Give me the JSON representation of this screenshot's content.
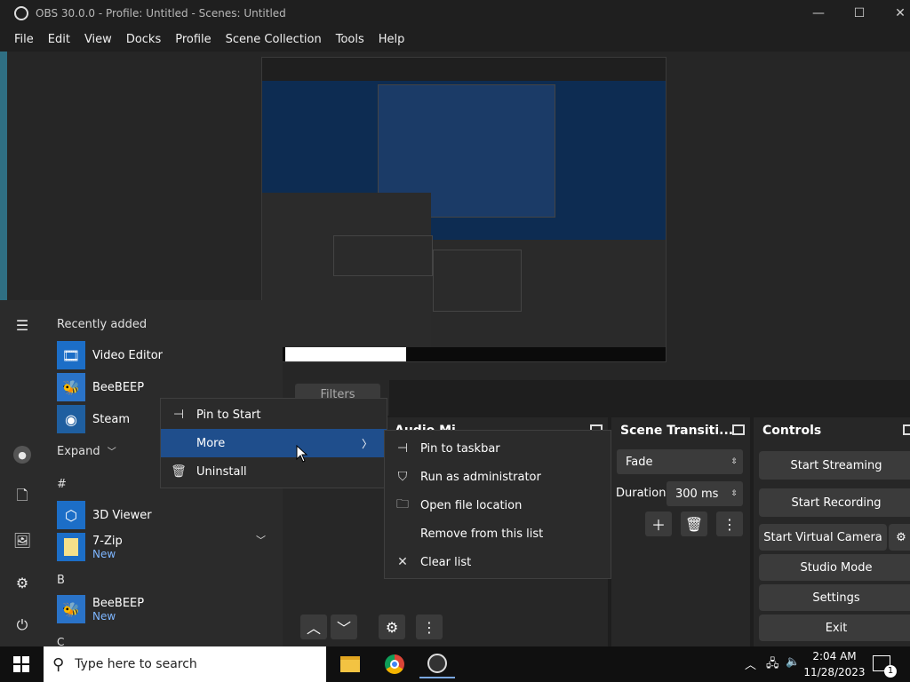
{
  "obs": {
    "window_title": "OBS 30.0.0 - Profile: Untitled - Scenes: Untitled",
    "menu": [
      "File",
      "Edit",
      "View",
      "Docks",
      "Profile",
      "Scene Collection",
      "Tools",
      "Help"
    ],
    "filters_label": "Filters",
    "audio_mixer_title": "Audio Mi",
    "scene_transitions": {
      "title": "Scene Transiti...",
      "transition": "Fade",
      "duration_label": "Duration",
      "duration_value": "300 ms"
    },
    "controls": {
      "title": "Controls",
      "start_streaming": "Start Streaming",
      "start_recording": "Start Recording",
      "start_virtual_camera": "Start Virtual Camera",
      "studio_mode": "Studio Mode",
      "settings": "Settings",
      "exit": "Exit"
    }
  },
  "start_menu": {
    "recently_added": "Recently added",
    "expand": "Expand",
    "apps": {
      "video_editor": "Video Editor",
      "beebeep": "BeeBEEP",
      "steam": "Steam",
      "viewer3d": "3D Viewer",
      "sevenzip": "7-Zip",
      "sevenzip_badge": "New",
      "beebeep_b": "BeeBEEP",
      "beebeep_b_badge": "New"
    },
    "sections": {
      "hash": "#",
      "b": "B",
      "c": "C"
    }
  },
  "context_menu": {
    "pin_to_start": "Pin to Start",
    "more": "More",
    "uninstall": "Uninstall"
  },
  "submenu": {
    "pin_to_taskbar": "Pin to taskbar",
    "run_as_admin": "Run as administrator",
    "open_file_location": "Open file location",
    "remove_from_list": "Remove from this list",
    "clear_list": "Clear list"
  },
  "taskbar": {
    "search_placeholder": "Type here to search",
    "time": "2:04 AM",
    "date": "11/28/2023",
    "notification_count": "1"
  },
  "colors": {
    "highlight": "#1f4e8c",
    "badge_new": "#7eb6ff"
  }
}
